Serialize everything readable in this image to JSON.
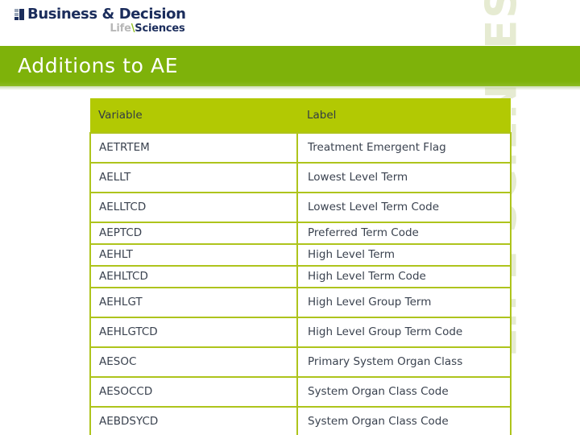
{
  "logo": {
    "mark_icon": "squares-grid-icon",
    "company": "Business & Decision",
    "division_prefix": "Life",
    "division_separator": "\\",
    "division_suffix": "Sciences"
  },
  "banner": {
    "title": "Additions to AE",
    "color": "#7eb20a"
  },
  "watermark": {
    "text": "LIFE SCIENCES",
    "color": "#e6ebd2"
  },
  "table": {
    "header_color": "#b2c903",
    "border_color": "#aec41c",
    "columns": [
      "Variable",
      "Label"
    ],
    "rows": [
      {
        "variable": "AETRTEM",
        "label": "Treatment Emergent Flag",
        "tight": false
      },
      {
        "variable": "AELLT",
        "label": "Lowest Level Term",
        "tight": false
      },
      {
        "variable": "AELLTCD",
        "label": "Lowest Level Term Code",
        "tight": false
      },
      {
        "variable": "AEPTCD",
        "label": "Preferred Term Code",
        "tight": true
      },
      {
        "variable": "AEHLT",
        "label": "High Level Term",
        "tight": true
      },
      {
        "variable": "AEHLTCD",
        "label": "High Level Term Code",
        "tight": true
      },
      {
        "variable": "AEHLGT",
        "label": "High Level Group Term",
        "tight": false
      },
      {
        "variable": "AEHLGTCD",
        "label": "High Level Group Term Code",
        "tight": false
      },
      {
        "variable": "AESOC",
        "label": "Primary System Organ Class",
        "tight": false
      },
      {
        "variable": "AESOCCD",
        "label": "System Organ Class Code",
        "tight": false
      },
      {
        "variable": "AEBDSYCD",
        "label": "System Organ Class Code",
        "tight": false
      }
    ]
  }
}
